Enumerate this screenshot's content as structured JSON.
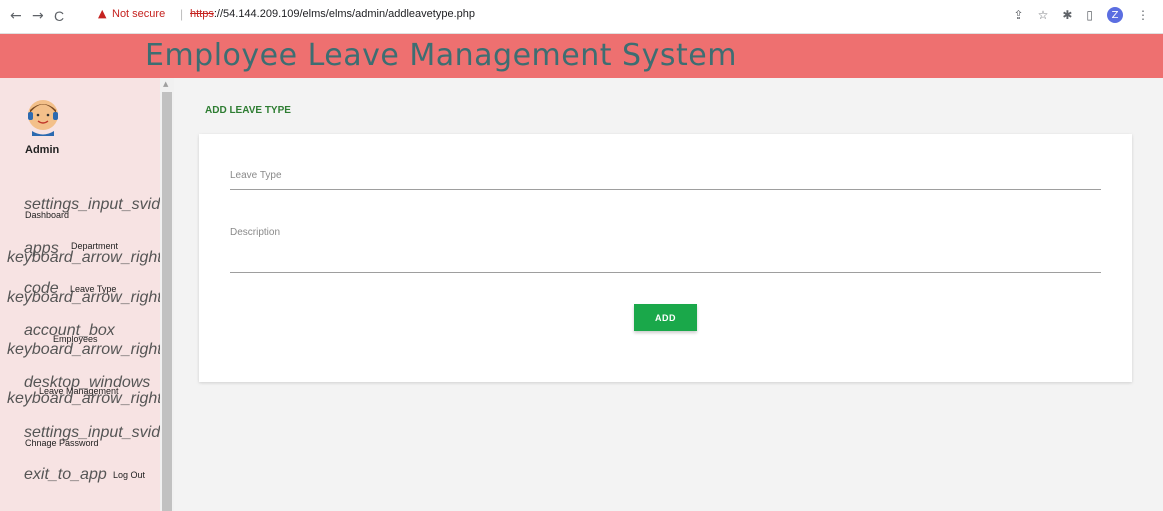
{
  "browser": {
    "back_icon": "←",
    "forward_icon": "→",
    "reload_icon": "C",
    "warning_icon": "▲",
    "not_secure_label": "Not secure",
    "separator": "|",
    "url_scheme": "https",
    "url_rest": "://54.144.209.109/elms/elms/admin/addleavetype.php",
    "profile_initial": "Z"
  },
  "header": {
    "title": "Employee Leave Management System"
  },
  "sidebar": {
    "user_name": "Admin",
    "items": [
      {
        "icon": "settings_input_svideo",
        "label": "Dashboard",
        "arrow": ""
      },
      {
        "icon": "apps",
        "label": "Department",
        "arrow": "keyboard_arrow_right"
      },
      {
        "icon": "code",
        "label": "Leave Type",
        "arrow": "keyboard_arrow_right"
      },
      {
        "icon": "account_box",
        "label": "Employees",
        "arrow": "keyboard_arrow_right"
      },
      {
        "icon": "desktop_windows",
        "label": "Leave Management",
        "arrow": "keyboard_arrow_right"
      },
      {
        "icon": "settings_input_svideo",
        "label": "Chnage Password",
        "arrow": ""
      },
      {
        "icon": "exit_to_app",
        "label": "Log Out",
        "arrow": ""
      }
    ]
  },
  "main": {
    "page_title": "ADD LEAVE TYPE",
    "form": {
      "leave_type_label": "Leave Type",
      "leave_type_value": "",
      "description_label": "Description",
      "description_value": "",
      "submit_label": "ADD"
    }
  },
  "colors": {
    "header_bg": "#ee7070",
    "title_color": "#3d6e72",
    "sidebar_bg": "#f7e3e3",
    "button_bg": "#1aa84a",
    "page_title_color": "#2e7d32"
  }
}
